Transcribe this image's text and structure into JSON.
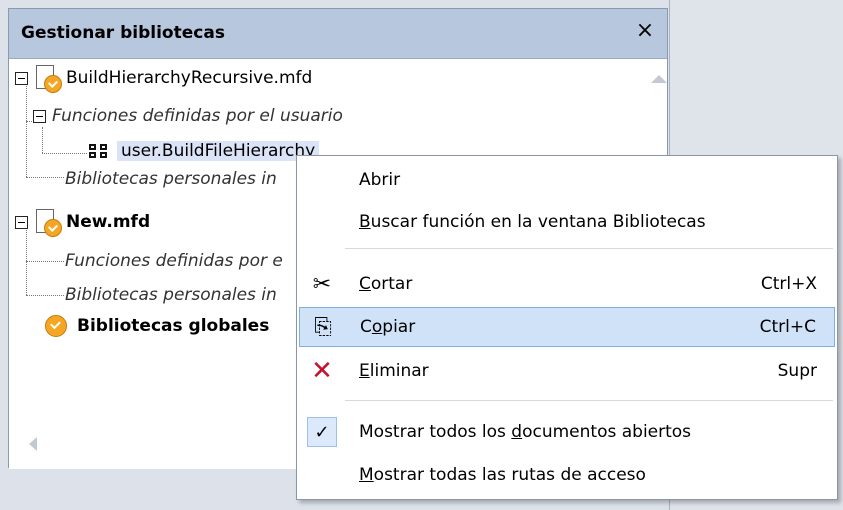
{
  "panel": {
    "title": "Gestionar bibliotecas",
    "close": "×"
  },
  "tree": {
    "file1": {
      "name": "BuildHierarchyRecursive.mfd"
    },
    "udf1": {
      "label": "Funciones definidas por el usuario"
    },
    "func1": {
      "label": "user.BuildFileHierarchy"
    },
    "lib1": {
      "label": "Bibliotecas personales in"
    },
    "file2": {
      "name": "New.mfd"
    },
    "udf2": {
      "label": "Funciones definidas por e"
    },
    "lib2": {
      "label": "Bibliotecas personales in"
    },
    "global": {
      "label": "Bibliotecas globales"
    }
  },
  "menu": {
    "open": {
      "label": "Abrir"
    },
    "find": {
      "pre": "",
      "u": "B",
      "post": "uscar función en la ventana Bibliotecas"
    },
    "cut": {
      "pre": "",
      "u": "C",
      "post": "ortar",
      "shortcut": "Ctrl+X"
    },
    "copy": {
      "pre": "C",
      "u": "o",
      "post": "piar",
      "shortcut": "Ctrl+C"
    },
    "delete": {
      "pre": "",
      "u": "E",
      "post": "liminar",
      "shortcut": "Supr"
    },
    "show_docs": {
      "pre": "Mostrar todos los ",
      "u": "d",
      "post": "ocumentos abiertos"
    },
    "show_paths": {
      "pre": "",
      "u": "M",
      "post": "ostrar todas las rutas de acceso"
    }
  },
  "colors": {
    "header": "#b7c7dd",
    "highlight": "#cfe2f8",
    "badge": "#f5a623",
    "delete_red": "#c8102e"
  }
}
